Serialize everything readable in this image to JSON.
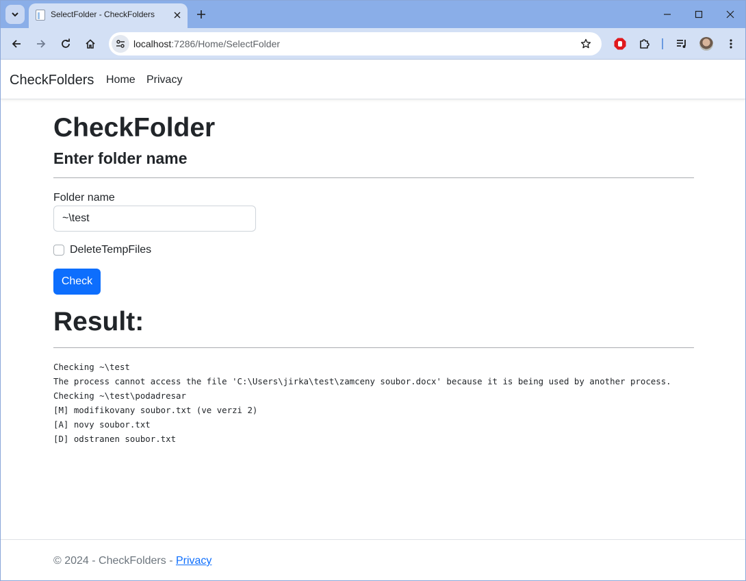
{
  "browser": {
    "tab_title": "SelectFolder - CheckFolders",
    "url_host": "localhost",
    "url_path": ":7286/Home/SelectFolder"
  },
  "navbar": {
    "brand": "CheckFolders",
    "links": [
      "Home",
      "Privacy"
    ]
  },
  "main": {
    "title": "CheckFolder",
    "subtitle": "Enter folder name",
    "folder_label": "Folder name",
    "folder_value": "~\\test",
    "checkbox_label": "DeleteTempFiles",
    "checkbox_checked": false,
    "check_button": "Check",
    "result_heading": "Result:",
    "result_lines": [
      "Checking ~\\test",
      "The process cannot access the file 'C:\\Users\\jirka\\test\\zamceny soubor.docx' because it is being used by another process.",
      "Checking ~\\test\\podadresar",
      "[M] modifikovany soubor.txt (ve verzi 2)",
      "[A] novy soubor.txt",
      "[D] odstranen soubor.txt"
    ]
  },
  "footer": {
    "text": "© 2024 - CheckFolders - ",
    "link": "Privacy"
  },
  "colors": {
    "primary": "#0d6efd",
    "tabstrip": "#8aaee8",
    "toolbar": "#d3e0f5"
  }
}
